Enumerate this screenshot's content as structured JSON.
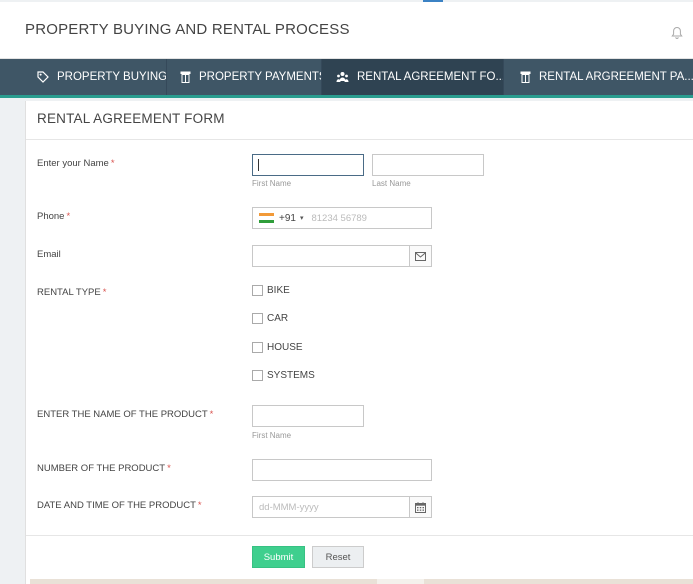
{
  "app": {
    "title": "PROPERTY BUYING AND RENTAL PROCESS"
  },
  "tabs": [
    {
      "label": "PROPERTY BUYING",
      "icon": "tag-icon"
    },
    {
      "label": "PROPERTY PAYMENTS",
      "icon": "table-icon"
    },
    {
      "label": "RENTAL AGREEMENT FO...",
      "icon": "people-icon",
      "active": true
    },
    {
      "label": "RENTAL ARGREEMENT PA...",
      "icon": "table-icon"
    }
  ],
  "form": {
    "title": "RENTAL AGREEMENT FORM",
    "name": {
      "label": "Enter your Name",
      "first_sub": "First Name",
      "last_sub": "Last Name",
      "first_value": "",
      "last_value": ""
    },
    "phone": {
      "label": "Phone",
      "code": "+91",
      "placeholder": "81234 56789"
    },
    "email": {
      "label": "Email",
      "value": ""
    },
    "rental_type": {
      "label": "RENTAL TYPE",
      "options": [
        "BIKE",
        "CAR",
        "HOUSE",
        "SYSTEMS"
      ]
    },
    "product_name": {
      "label": "ENTER THE NAME OF THE PRODUCT",
      "sub": "First Name",
      "value": ""
    },
    "product_number": {
      "label": "NUMBER OF THE PRODUCT",
      "value": ""
    },
    "product_datetime": {
      "label": "DATE AND TIME OF THE PRODUCT",
      "placeholder": "dd-MMM-yyyy"
    },
    "required_mark": "*",
    "submit_label": "Submit",
    "reset_label": "Reset"
  },
  "colors": {
    "tabbar": "#3f5666",
    "tab_active": "#2f4352",
    "accent_line": "#2a9d8f",
    "submit": "#3fcf8e",
    "required": "#d9534f"
  }
}
